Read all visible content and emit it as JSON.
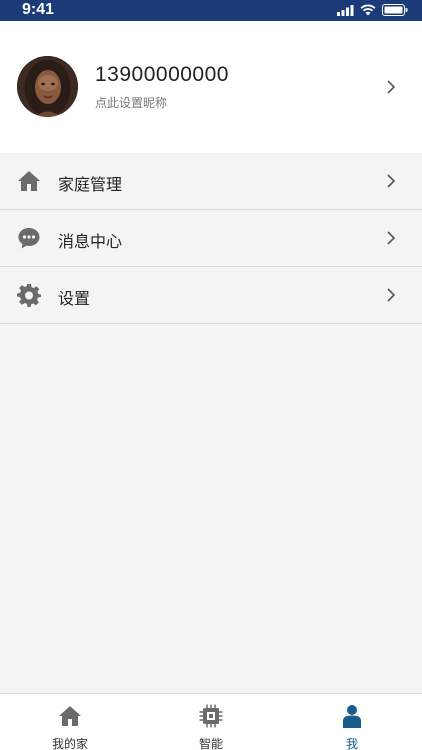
{
  "status_bar": {
    "time": "9:41"
  },
  "profile": {
    "phone": "13900000000",
    "nickname_hint": "点此设置昵称"
  },
  "menu": {
    "items": [
      {
        "label": "家庭管理",
        "icon": "home-icon"
      },
      {
        "label": "消息中心",
        "icon": "message-icon"
      },
      {
        "label": "设置",
        "icon": "gear-icon"
      }
    ]
  },
  "tabbar": {
    "tabs": [
      {
        "label": "我的家",
        "icon": "home-icon",
        "active": false
      },
      {
        "label": "智能",
        "icon": "chip-icon",
        "active": false
      },
      {
        "label": "我",
        "icon": "person-icon",
        "active": true
      }
    ]
  },
  "colors": {
    "status_bar": "#1b3a78",
    "active_tab": "#1b5b8c",
    "icon_gray": "#6b6b6b"
  }
}
